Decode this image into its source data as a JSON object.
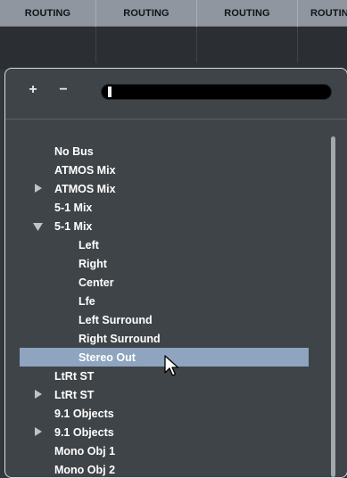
{
  "header": {
    "columns": [
      "ROUTING",
      "ROUTING",
      "ROUTING",
      "ROUTING"
    ]
  },
  "toolbar": {
    "add_label": "+",
    "remove_label": "−",
    "search_value": "",
    "search_placeholder": ""
  },
  "bus_list": {
    "items": [
      {
        "label": "No Bus",
        "indent": 0,
        "arrow": ""
      },
      {
        "label": "ATMOS Mix",
        "indent": 0,
        "arrow": ""
      },
      {
        "label": "ATMOS Mix",
        "indent": 0,
        "arrow": "collapsed"
      },
      {
        "label": "5-1 Mix",
        "indent": 0,
        "arrow": ""
      },
      {
        "label": "5-1 Mix",
        "indent": 0,
        "arrow": "expanded"
      },
      {
        "label": "Left",
        "indent": 1,
        "arrow": ""
      },
      {
        "label": "Right",
        "indent": 1,
        "arrow": ""
      },
      {
        "label": "Center",
        "indent": 1,
        "arrow": ""
      },
      {
        "label": "Lfe",
        "indent": 1,
        "arrow": ""
      },
      {
        "label": "Left Surround",
        "indent": 1,
        "arrow": ""
      },
      {
        "label": "Right Surround",
        "indent": 1,
        "arrow": ""
      },
      {
        "label": "Stereo Out",
        "indent": 1,
        "arrow": "",
        "selected": true
      },
      {
        "label": "LtRt ST",
        "indent": 0,
        "arrow": ""
      },
      {
        "label": "LtRt ST",
        "indent": 0,
        "arrow": "collapsed"
      },
      {
        "label": "9.1 Objects",
        "indent": 0,
        "arrow": ""
      },
      {
        "label": "9.1 Objects",
        "indent": 0,
        "arrow": "collapsed"
      },
      {
        "label": "Mono Obj 1",
        "indent": 0,
        "arrow": ""
      },
      {
        "label": "Mono Obj 2",
        "indent": 0,
        "arrow": ""
      }
    ]
  },
  "colors": {
    "selection": "#8ea4bf",
    "header_bg": "#8f96a0",
    "panel_bg": "#3f4448"
  },
  "icons": {
    "expand": "triangle-right-icon",
    "collapse": "triangle-down-icon",
    "pointer": "mouse-pointer-icon"
  }
}
